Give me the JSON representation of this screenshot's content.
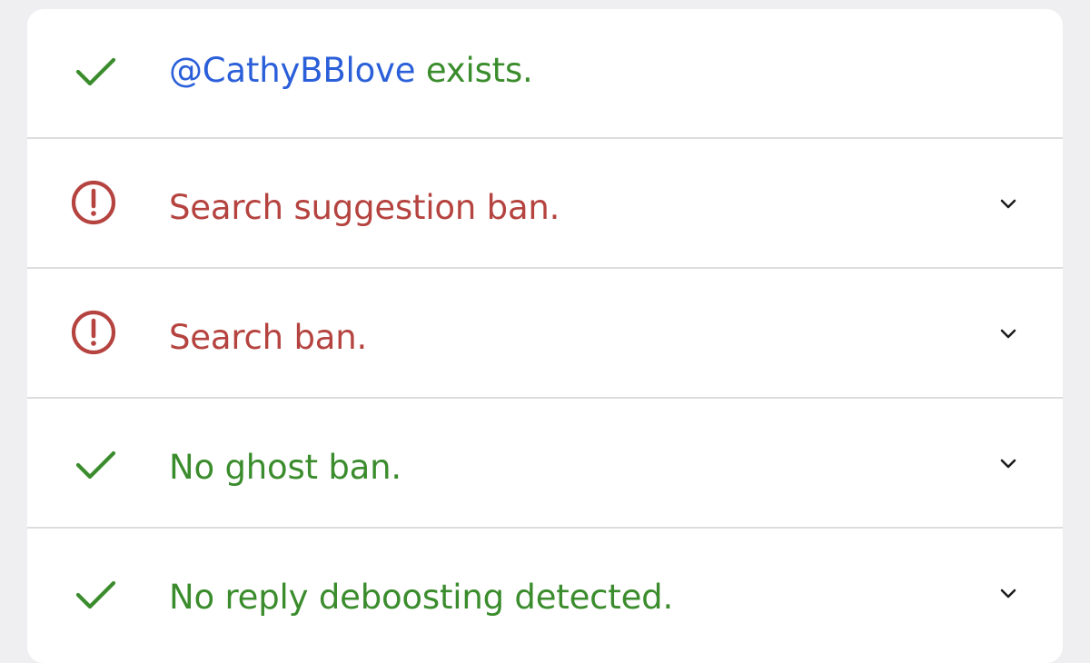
{
  "colors": {
    "success": "#3a8c2c",
    "error": "#b5433f",
    "link": "#2b5fd9",
    "chevron": "#1d1d1f",
    "divider": "#dddddf"
  },
  "rows": [
    {
      "status": "success",
      "icon": "checkmark-icon",
      "link_text": "@CathyBBlove",
      "text": " exists.",
      "expandable": false
    },
    {
      "status": "error",
      "icon": "exclamation-circle-icon",
      "text": "Search suggestion ban.",
      "expandable": true
    },
    {
      "status": "error",
      "icon": "exclamation-circle-icon",
      "text": "Search ban.",
      "expandable": true
    },
    {
      "status": "success",
      "icon": "checkmark-icon",
      "text": "No ghost ban.",
      "expandable": true
    },
    {
      "status": "success",
      "icon": "checkmark-icon",
      "text": "No reply deboosting detected.",
      "expandable": true
    }
  ]
}
